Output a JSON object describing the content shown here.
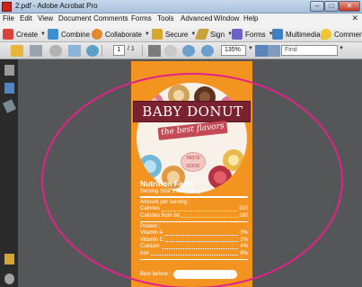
{
  "window": {
    "title": "2.pdf - Adobe Acrobat Pro"
  },
  "menu": {
    "items": [
      "File",
      "Edit",
      "View",
      "Document",
      "Comments",
      "Forms",
      "Tools",
      "Advanced",
      "Window",
      "Help"
    ]
  },
  "toolbar": {
    "create": "Create",
    "combine": "Combine",
    "collaborate": "Collaborate",
    "secure": "Secure",
    "sign": "Sign",
    "forms": "Forms",
    "multimedia": "Multimedia",
    "comment": "Comment"
  },
  "nav": {
    "current_page": "1",
    "total_pages": "/ 1",
    "zoom": "135%",
    "find_placeholder": "Find"
  },
  "poster": {
    "title": "BABY DONUT",
    "subtitle": "the best flavors",
    "badge": "TASTE GOOD",
    "nutrition_title": "Nutrition Facts",
    "serving": "Serving Size 1 donut 67g",
    "amount_label": "Amount per serving :",
    "rows_a": [
      {
        "label": "Calories",
        "value": "310"
      },
      {
        "label": "Calories from fat",
        "value": "160"
      }
    ],
    "protein_label": "Protein :",
    "rows_b": [
      {
        "label": "Vitamin A",
        "value": "3%"
      },
      {
        "label": "Vitamin C",
        "value": "2%"
      },
      {
        "label": "Calcium",
        "value": "4%"
      },
      {
        "label": "Iron",
        "value": "8%"
      }
    ],
    "best_before": "Best before :"
  },
  "colors": {
    "poster_bg": "#f49420",
    "banner": "#7a2230",
    "ring": "#e2228b"
  }
}
